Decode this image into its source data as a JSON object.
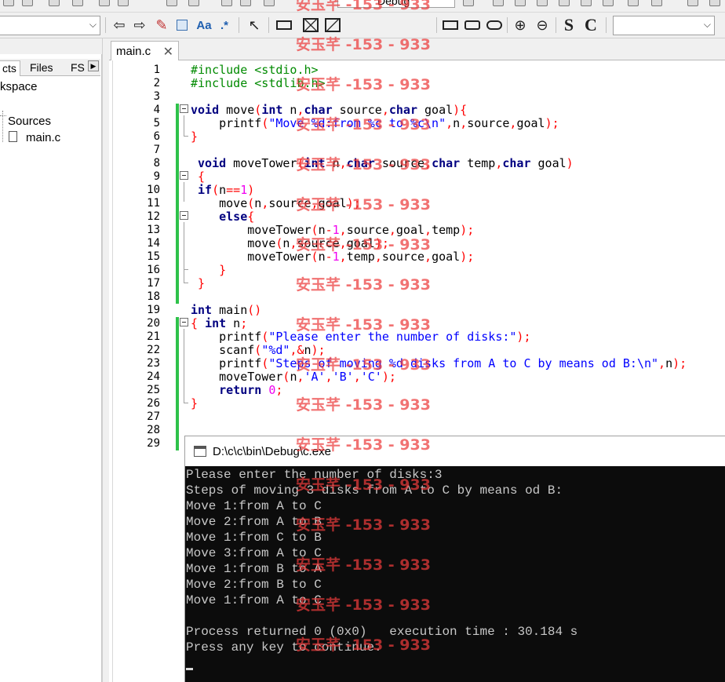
{
  "toolbar": {
    "target_combo_value": "",
    "search_combo_value": "",
    "top_combo_value": "Debug",
    "btn_back": "⇦",
    "btn_forward": "⇨",
    "btn_highlight": "✎",
    "btn_replace": "Aa",
    "btn_regex": ".*",
    "btn_select": "↖",
    "btn_zoom_in": "⊕",
    "btn_zoom_out": "⊖",
    "btn_S": "S",
    "btn_C": "C"
  },
  "left_panel": {
    "header_fragment": "",
    "tabs": [
      {
        "label": "cts"
      },
      {
        "label": "Files"
      },
      {
        "label": "FS"
      }
    ],
    "tab_scroll": "▶",
    "workspace_label": "kspace",
    "sources_label": "Sources",
    "file_label": "main.c"
  },
  "editor": {
    "tab_label": "main.c",
    "tab_close": "✕",
    "line_numbers": [
      "1",
      "2",
      "3",
      "4",
      "5",
      "6",
      "7",
      "8",
      "9",
      "10",
      "11",
      "12",
      "13",
      "14",
      "15",
      "16",
      "17",
      "18",
      "19",
      "20",
      "21",
      "22",
      "23",
      "24",
      "25",
      "26",
      "27",
      "28",
      "29"
    ]
  },
  "console": {
    "title": "D:\\c\\c\\bin\\Debug\\c.exe",
    "lines": [
      "Please enter the number of disks:3",
      "Steps of moving 3 disks from A to C by means od B:",
      "Move 1:from A to C",
      "Move 2:from A to B",
      "Move 1:from C to B",
      "Move 3:from A to C",
      "Move 1:from B to A",
      "Move 2:from B to C",
      "Move 1:from A to C",
      "",
      "Process returned 0 (0x0)   execution time : 30.184 s",
      "Press any key to continue."
    ]
  },
  "watermark": "安玉芊 -153 - 933",
  "colors": {
    "keyword": "#000080",
    "preprocessor": "#008a00",
    "string": "#0000ff",
    "number": "#f000f0",
    "operator": "#ff0000",
    "change_bar": "#2ec24a",
    "watermark": "#ec3c3c",
    "console_bg": "#0c0c0c",
    "console_text": "#c8c8c8"
  }
}
